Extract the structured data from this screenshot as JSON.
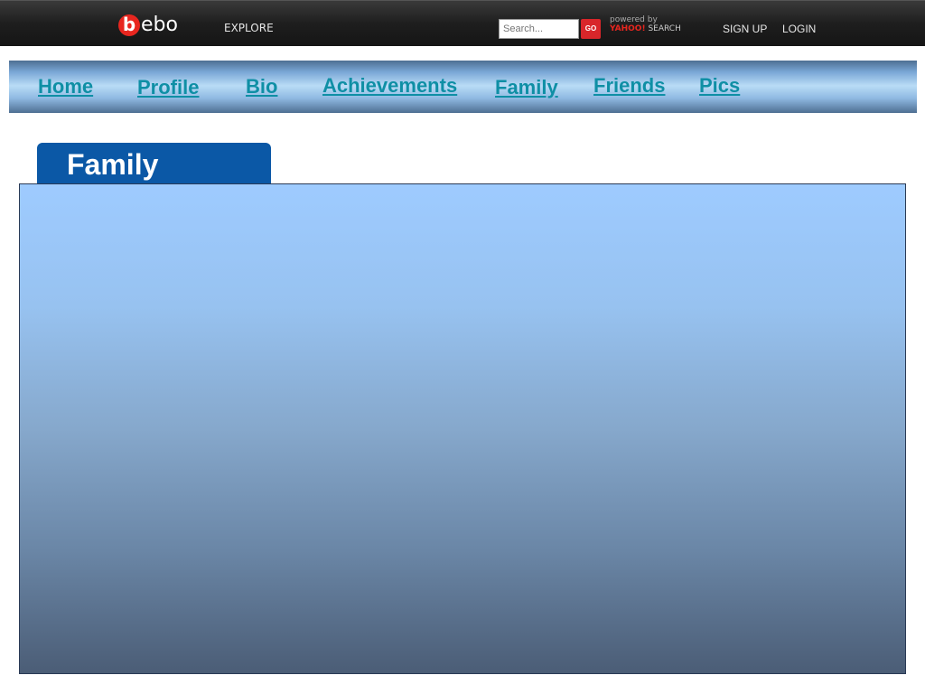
{
  "header": {
    "logo_b": "b",
    "logo_text": "ebo",
    "explore_label": "EXPLORE",
    "search": {
      "placeholder": "Search..."
    },
    "go_label": "GO",
    "powered_by": "powered by",
    "yahoo": "YAHOO!",
    "search_word": "SEARCH",
    "signup_label": "SIGN UP",
    "login_label": "LOGIN"
  },
  "nav": {
    "items": [
      {
        "label": "Home"
      },
      {
        "label": "Profile"
      },
      {
        "label": "Bio"
      },
      {
        "label": "Achievements"
      },
      {
        "label": "Family"
      },
      {
        "label": "Friends"
      },
      {
        "label": "Pics"
      }
    ]
  },
  "section": {
    "tab_label": "Family"
  },
  "colors": {
    "brand_red": "#e8261f",
    "nav_link": "#0f8fa5",
    "tab_blue": "#0b58a6"
  }
}
